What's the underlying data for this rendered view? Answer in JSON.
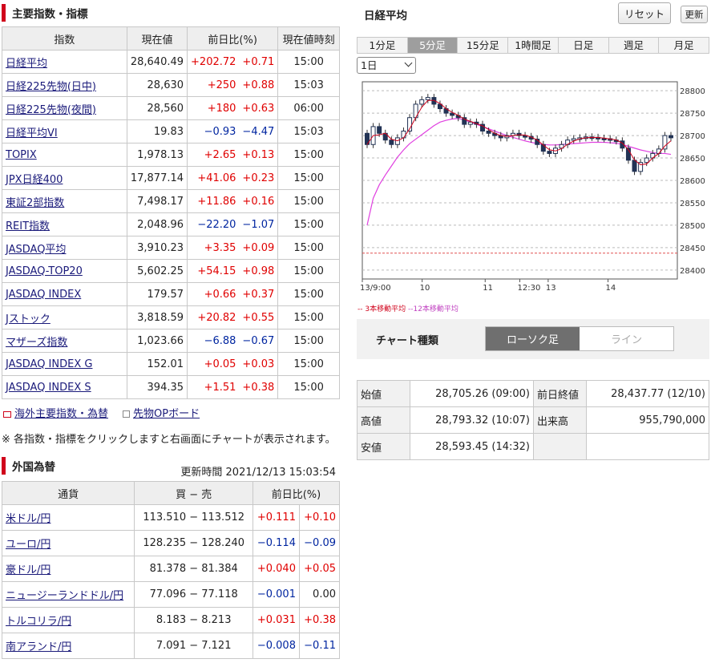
{
  "indices_section": {
    "title": "主要指数・指標",
    "headers": [
      "指数",
      "現在値",
      "前日比(%)",
      "現在値時刻"
    ],
    "rows": [
      {
        "name": "日経平均",
        "value": "28,640.49",
        "change": "+202.72",
        "pct": "+0.71",
        "time": "15:00",
        "c": "up",
        "p": "up"
      },
      {
        "name": "日経225先物(日中)",
        "value": "28,630",
        "change": "+250",
        "pct": "+0.88",
        "time": "15:03",
        "c": "up",
        "p": "up"
      },
      {
        "name": "日経225先物(夜間)",
        "value": "28,560",
        "change": "+180",
        "pct": "+0.63",
        "time": "06:00",
        "c": "up",
        "p": "up"
      },
      {
        "name": "日経平均VI",
        "value": "19.83",
        "change": "−0.93",
        "pct": "−4.47",
        "time": "15:03",
        "c": "dn",
        "p": "dn"
      },
      {
        "name": "TOPIX",
        "value": "1,978.13",
        "change": "+2.65",
        "pct": "+0.13",
        "time": "15:00",
        "c": "up",
        "p": "up"
      },
      {
        "name": "JPX日経400",
        "value": "17,877.14",
        "change": "+41.06",
        "pct": "+0.23",
        "time": "15:00",
        "c": "up",
        "p": "up"
      },
      {
        "name": "東証2部指数",
        "value": "7,498.17",
        "change": "+11.86",
        "pct": "+0.16",
        "time": "15:00",
        "c": "up",
        "p": "up"
      },
      {
        "name": "REIT指数",
        "value": "2,048.96",
        "change": "−22.20",
        "pct": "−1.07",
        "time": "15:00",
        "c": "dn",
        "p": "dn"
      },
      {
        "name": "JASDAQ平均",
        "value": "3,910.23",
        "change": "+3.35",
        "pct": "+0.09",
        "time": "15:00",
        "c": "up",
        "p": "up"
      },
      {
        "name": "JASDAQ-TOP20",
        "value": "5,602.25",
        "change": "+54.15",
        "pct": "+0.98",
        "time": "15:00",
        "c": "up",
        "p": "up"
      },
      {
        "name": "JASDAQ INDEX",
        "value": "179.57",
        "change": "+0.66",
        "pct": "+0.37",
        "time": "15:00",
        "c": "up",
        "p": "up"
      },
      {
        "name": "Jストック",
        "value": "3,818.59",
        "change": "+20.82",
        "pct": "+0.55",
        "time": "15:00",
        "c": "up",
        "p": "up"
      },
      {
        "name": "マザーズ指数",
        "value": "1,023.66",
        "change": "−6.88",
        "pct": "−0.67",
        "time": "15:00",
        "c": "dn",
        "p": "dn"
      },
      {
        "name": "JASDAQ INDEX G",
        "value": "152.01",
        "change": "+0.05",
        "pct": "+0.03",
        "time": "15:00",
        "c": "up",
        "p": "up"
      },
      {
        "name": "JASDAQ INDEX S",
        "value": "394.35",
        "change": "+1.51",
        "pct": "+0.38",
        "time": "15:00",
        "c": "up",
        "p": "up"
      }
    ],
    "links": [
      "海外主要指数・為替",
      "先物OPボード"
    ],
    "note": "※ 各指数・指標をクリックしますと右画面にチャートが表示されます。"
  },
  "fx_section": {
    "title": "外国為替",
    "updated": "更新時間 2021/12/13 15:03:54",
    "headers": [
      "通貨",
      "買 − 売",
      "前日比(%)"
    ],
    "rows": [
      {
        "name": "米ドル/円",
        "bidask": "113.510 − 113.512",
        "change": "+0.111",
        "pct": "+0.10",
        "c": "up",
        "p": "up"
      },
      {
        "name": "ユーロ/円",
        "bidask": "128.235 − 128.240",
        "change": "−0.114",
        "pct": "−0.09",
        "c": "dn",
        "p": "dn"
      },
      {
        "name": "豪ドル/円",
        "bidask": "81.378 − 81.384",
        "change": "+0.040",
        "pct": "+0.05",
        "c": "up",
        "p": "up"
      },
      {
        "name": "ニュージーランドドル/円",
        "bidask": "77.096 − 77.118",
        "change": "−0.001",
        "pct": "0.00",
        "c": "dn",
        "p": "nt"
      },
      {
        "name": "トルコリラ/円",
        "bidask": "8.183 − 8.213",
        "change": "+0.031",
        "pct": "+0.38",
        "c": "up",
        "p": "up"
      },
      {
        "name": "南アランド/円",
        "bidask": "7.091 − 7.121",
        "change": "−0.008",
        "pct": "−0.11",
        "c": "dn",
        "p": "dn"
      }
    ]
  },
  "chart_panel": {
    "title": "日経平均",
    "reset_label": "リセット",
    "refresh_label": "更新",
    "tabs": [
      "1分足",
      "5分足",
      "15分足",
      "1時間足",
      "日足",
      "週足",
      "月足"
    ],
    "active_tab": 1,
    "range_select": "1日",
    "legend_ma3": "3本移動平均",
    "legend_ma12": "12本移動平均",
    "chart_type_label": "チャート種類",
    "chart_type_options": [
      "ローソク足",
      "ライン"
    ],
    "chart_type_active": 0
  },
  "chart_data": {
    "type": "line",
    "y_ticks": [
      28400,
      28450,
      28500,
      28550,
      28600,
      28650,
      28700,
      28750,
      28800
    ],
    "ylim": [
      28380,
      28820
    ],
    "x_labels": [
      "13/9:00",
      "10",
      "11",
      "12:30",
      "13",
      "14"
    ],
    "prev_close": 28437.77,
    "close_series": [
      28680,
      28720,
      28705,
      28690,
      28680,
      28695,
      28710,
      28740,
      28770,
      28780,
      28785,
      28770,
      28760,
      28750,
      28745,
      28740,
      28725,
      28730,
      28725,
      28710,
      28705,
      28700,
      28695,
      28700,
      28705,
      28700,
      28698,
      28692,
      28680,
      28665,
      28660,
      28672,
      28680,
      28690,
      28693,
      28695,
      28697,
      28696,
      28694,
      28693,
      28690,
      28688,
      28672,
      28645,
      28620,
      28640,
      28650,
      28660,
      28670,
      28700,
      28695
    ],
    "ma12_series": [
      28500,
      28560,
      28590,
      28612,
      28632,
      28652,
      28668,
      28682,
      28692,
      28702,
      28712,
      28722,
      28730,
      28734,
      28737,
      28738,
      28735,
      28730,
      28725,
      28720,
      28715,
      28710,
      28705,
      28700,
      28696,
      28692,
      28688,
      28685,
      28682,
      28680,
      28679,
      28679,
      28680,
      28681,
      28682,
      28683,
      28684,
      28685,
      28685,
      28685,
      28684,
      28683,
      28680,
      28676,
      28672,
      28668,
      28665,
      28662,
      28660,
      28660,
      28658
    ],
    "ohlc_summary": {
      "open": "28,705.26 (09:00)",
      "high": "28,793.32 (10:07)",
      "low": "28,593.45 (14:32)",
      "prev_close": "28,437.77 (12/10)",
      "volume": "955,790,000"
    }
  },
  "stats_labels": {
    "open": "始値",
    "high": "高値",
    "low": "安値",
    "prev_close": "前日終値",
    "volume": "出来高"
  }
}
